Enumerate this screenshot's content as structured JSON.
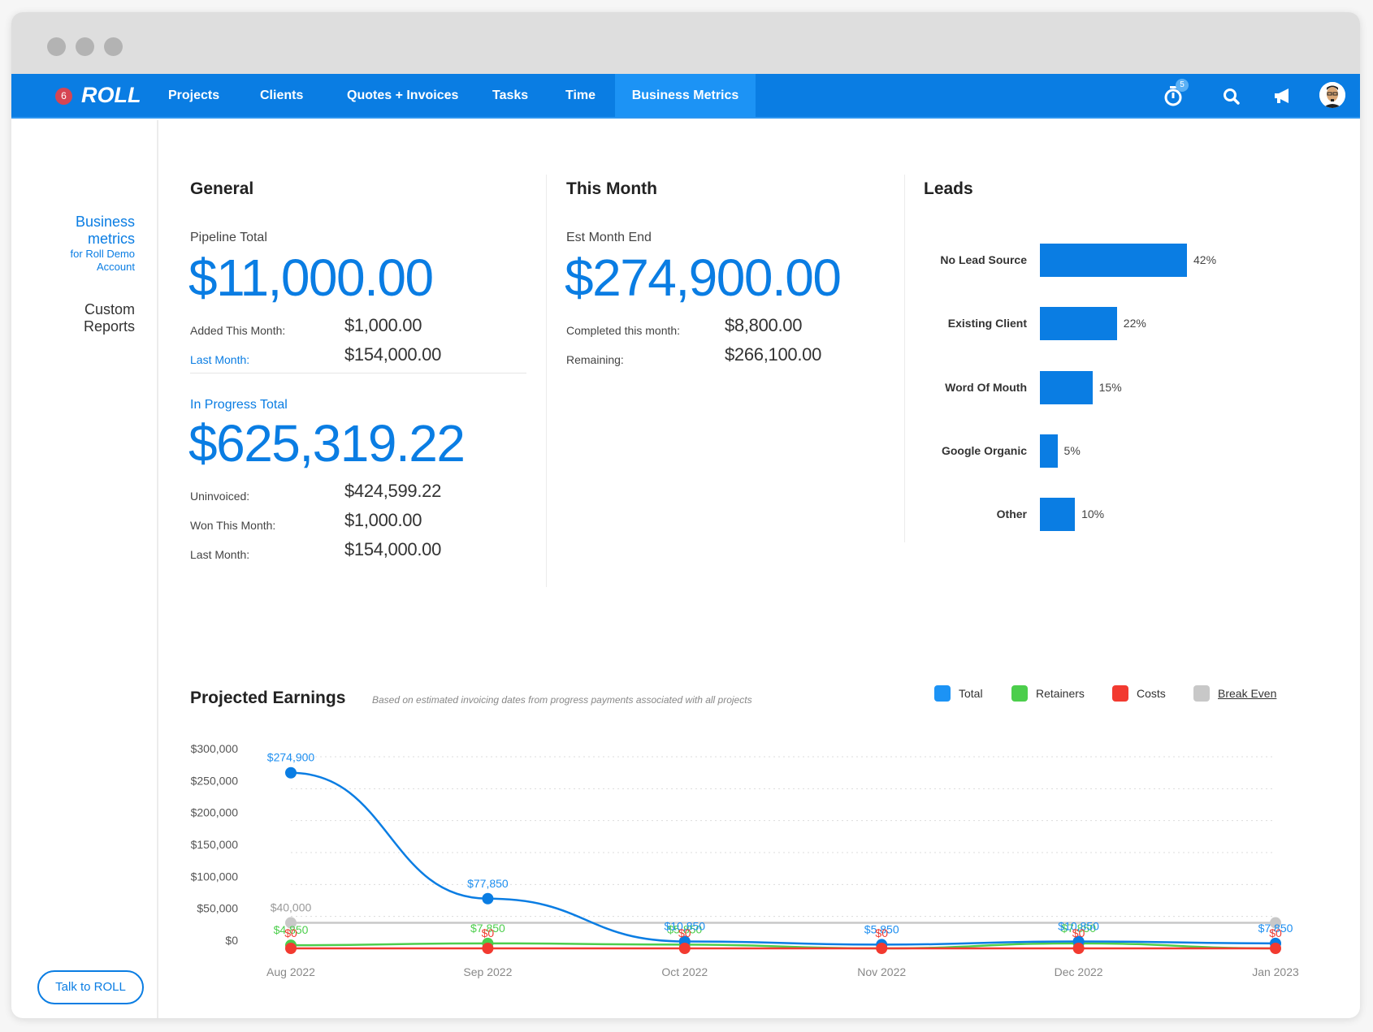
{
  "nav": {
    "notification_count": "6",
    "logo": "ROLL",
    "items": [
      {
        "label": "Projects",
        "active": false
      },
      {
        "label": "Clients",
        "active": false
      },
      {
        "label": "Quotes + Invoices",
        "active": false
      },
      {
        "label": "Tasks",
        "active": false
      },
      {
        "label": "Time",
        "active": false
      },
      {
        "label": "Business Metrics",
        "active": true
      }
    ],
    "timer_badge": "5",
    "icons": [
      "stopwatch-icon",
      "search-icon",
      "megaphone-icon",
      "avatar"
    ]
  },
  "sidebar": {
    "active_title": "Business metrics",
    "active_sub": "for Roll Demo Account",
    "custom_reports": "Custom Reports",
    "talk_button": "Talk to ROLL"
  },
  "general": {
    "title": "General",
    "pipeline_label": "Pipeline Total",
    "pipeline_total": "$11,000.00",
    "added_label": "Added This Month:",
    "added_value": "$1,000.00",
    "last_month_label": "Last Month:",
    "last_month_value": "$154,000.00",
    "in_progress_label": "In Progress Total",
    "in_progress_total": "$625,319.22",
    "uninvoiced_label": "Uninvoiced:",
    "uninvoiced_value": "$424,599.22",
    "won_label": "Won This Month:",
    "won_value": "$1,000.00",
    "ip_last_month_label": "Last Month:",
    "ip_last_month_value": "$154,000.00"
  },
  "this_month": {
    "title": "This Month",
    "est_label": "Est Month End",
    "est_value": "$274,900.00",
    "completed_label": "Completed this month:",
    "completed_value": "$8,800.00",
    "remaining_label": "Remaining:",
    "remaining_value": "$266,100.00"
  },
  "leads": {
    "title": "Leads",
    "items": [
      {
        "label": "No Lead Source",
        "pct": 42,
        "text": "42%"
      },
      {
        "label": "Existing Client",
        "pct": 22,
        "text": "22%"
      },
      {
        "label": "Word Of Mouth",
        "pct": 15,
        "text": "15%"
      },
      {
        "label": "Google Organic",
        "pct": 5,
        "text": "5%"
      },
      {
        "label": "Other",
        "pct": 10,
        "text": "10%"
      }
    ]
  },
  "projected": {
    "title": "Projected Earnings",
    "subtitle": "Based on estimated invoicing dates from progress payments associated with all projects"
  },
  "chart_data": {
    "type": "line",
    "title": "Projected Earnings",
    "x": [
      "Aug 2022",
      "Sep 2022",
      "Oct 2022",
      "Nov 2022",
      "Dec 2022",
      "Jan 2023"
    ],
    "yticks": [
      "$0",
      "$50,000",
      "$100,000",
      "$150,000",
      "$200,000",
      "$250,000",
      "$300,000"
    ],
    "ylim": [
      0,
      300000
    ],
    "grid": true,
    "legend_position": "top-right",
    "series": [
      {
        "name": "Break Even",
        "color": "#c8c8c8",
        "values": [
          40000,
          null,
          null,
          null,
          null,
          40000
        ],
        "labels": [
          "$40,000",
          "",
          "",
          "",
          "",
          ""
        ],
        "underlined": true
      },
      {
        "name": "Retainers",
        "color": "#4cce4c",
        "values": [
          4850,
          7850,
          5850,
          0,
          7850,
          0
        ],
        "labels": [
          "$4,850",
          "$7,850",
          "$5,850",
          "",
          "$7,850",
          ""
        ]
      },
      {
        "name": "Total",
        "color": "#0a7de3",
        "values": [
          274900,
          77850,
          10850,
          5850,
          10850,
          7850
        ],
        "labels": [
          "$274,900",
          "$77,850",
          "$10,850",
          "$5,850",
          "$10,850",
          "$7,850"
        ]
      },
      {
        "name": "Costs",
        "color": "#f23a30",
        "values": [
          0,
          0,
          0,
          0,
          0,
          0
        ],
        "labels": [
          "$0",
          "$0",
          "$0",
          "$0",
          "$0",
          "$0"
        ]
      }
    ],
    "legend": [
      {
        "name": "Total",
        "color": "#1c93f5"
      },
      {
        "name": "Retainers",
        "color": "#4cce4c"
      },
      {
        "name": "Costs",
        "color": "#f23a30"
      },
      {
        "name": "Break Even",
        "color": "#c8c8c8"
      }
    ]
  }
}
